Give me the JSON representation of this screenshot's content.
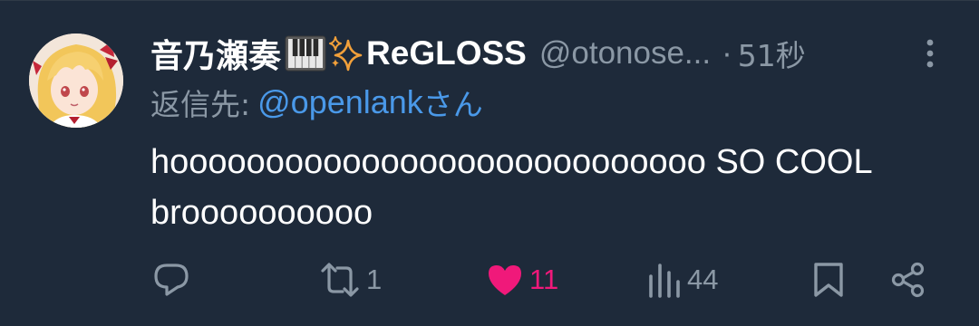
{
  "tweet": {
    "display_name": "音乃瀬奏",
    "display_name_suffix": "ReGLOSS",
    "handle": "@otonose...",
    "separator": "·",
    "timestamp": "51秒",
    "reply_label": "返信先:",
    "reply_target": "@openlank",
    "reply_honorific": "さん",
    "text": "hoooooooooooooooooooooooooooo SO COOL broooooooooo",
    "icons": {
      "avatar": "avatar",
      "piano": "piano-emoji",
      "sparkle": "sparkles-emoji",
      "more": "more-vertical-icon"
    }
  },
  "actions": {
    "reply": {
      "icon": "reply-icon",
      "count": ""
    },
    "retweet": {
      "icon": "retweet-icon",
      "count": "1"
    },
    "like": {
      "icon": "heart-icon",
      "count": "11",
      "liked": true
    },
    "views": {
      "icon": "views-icon",
      "count": "44"
    },
    "bookmark": {
      "icon": "bookmark-icon",
      "count": ""
    },
    "share": {
      "icon": "share-icon",
      "count": ""
    }
  },
  "colors": {
    "background": "#1e2a3a",
    "primary_text": "#ffffff",
    "secondary_text": "#8b98a5",
    "link": "#4a99e9",
    "like": "#f0197a"
  }
}
